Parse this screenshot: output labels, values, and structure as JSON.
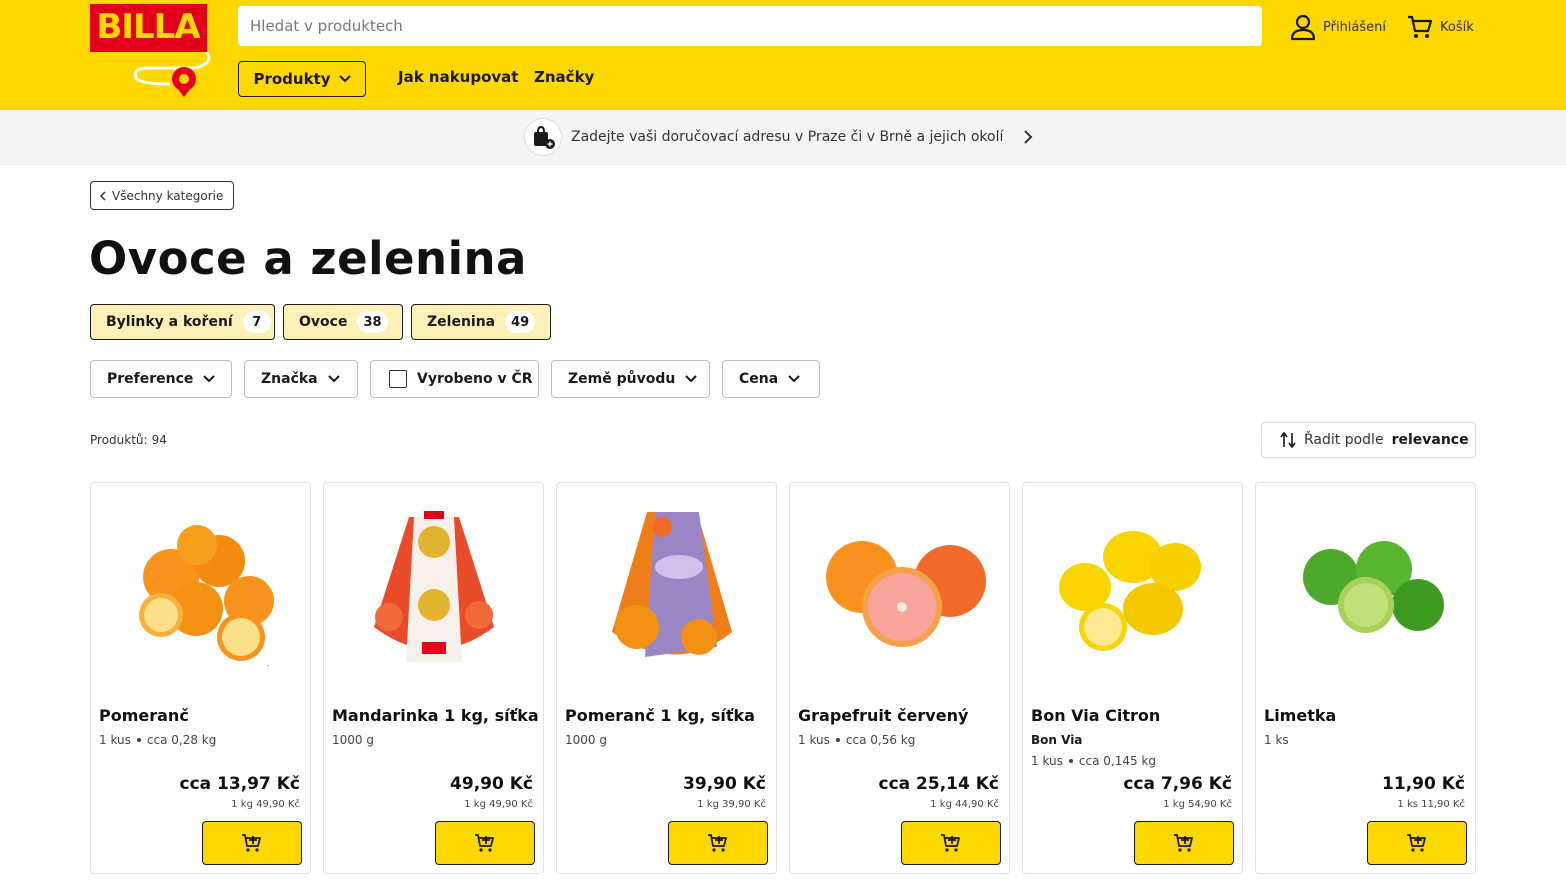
{
  "header": {
    "logo_text": "BILLA",
    "search_placeholder": "Hledat v produktech",
    "login_label": "Přihlášení",
    "cart_label": "Košík",
    "nav": {
      "products_label": "Produkty",
      "how_to_shop_label": "Jak nakupovat",
      "brands_label": "Značky"
    },
    "colors": {
      "brand_yellow": "#fdd700",
      "brand_red": "#e3001b"
    }
  },
  "delivery": {
    "text": "Zadejte vaši doručovací adresu v Praze či v Brně a jejich okolí"
  },
  "breadcrumb": {
    "back_label": "Všechny kategorie"
  },
  "page": {
    "title": "Ovoce a zelenina"
  },
  "categories": [
    {
      "label": "Bylinky a koření",
      "count": "7"
    },
    {
      "label": "Ovoce",
      "count": "38"
    },
    {
      "label": "Zelenina",
      "count": "49"
    }
  ],
  "filters": {
    "preference": "Preference",
    "brand": "Značka",
    "made_in_cz": "Vyrobeno v ČR",
    "origin": "Země původu",
    "price": "Cena"
  },
  "results": {
    "count_label": "Produktů:",
    "count": "94",
    "sort_prefix": "Řadit podle",
    "sort_value": "relevance"
  },
  "products": [
    {
      "name": "Pomeranč",
      "brand": "",
      "qty": "1 kus",
      "approx": "cca 0,28 kg",
      "price": "cca 13,97 Kč",
      "unit_price": "1 kg 49,90 Kč",
      "icon": "orange-fruit-image"
    },
    {
      "name": "Mandarinka 1 kg, síťka",
      "brand": "",
      "qty": "1000 g",
      "approx": "",
      "price": "49,90 Kč",
      "unit_price": "1 kg 49,90 Kč",
      "icon": "mandarin-net-image"
    },
    {
      "name": "Pomeranč 1 kg, síťka",
      "brand": "",
      "qty": "1000 g",
      "approx": "",
      "price": "39,90 Kč",
      "unit_price": "1 kg 39,90 Kč",
      "icon": "orange-net-image"
    },
    {
      "name": "Grapefruit červený",
      "brand": "",
      "qty": "1 kus",
      "approx": "cca 0,56 kg",
      "price": "cca 25,14 Kč",
      "unit_price": "1 kg 44,90 Kč",
      "icon": "grapefruit-image"
    },
    {
      "name": "Bon Via Citron",
      "brand": "Bon Via",
      "qty": "1 kus",
      "approx": "cca 0,145 kg",
      "price": "cca 7,96 Kč",
      "unit_price": "1 kg 54,90 Kč",
      "icon": "lemon-image"
    },
    {
      "name": "Limetka",
      "brand": "",
      "qty": "1 ks",
      "approx": "",
      "price": "11,90 Kč",
      "unit_price": "1 ks 11,90 Kč",
      "icon": "lime-image"
    }
  ]
}
